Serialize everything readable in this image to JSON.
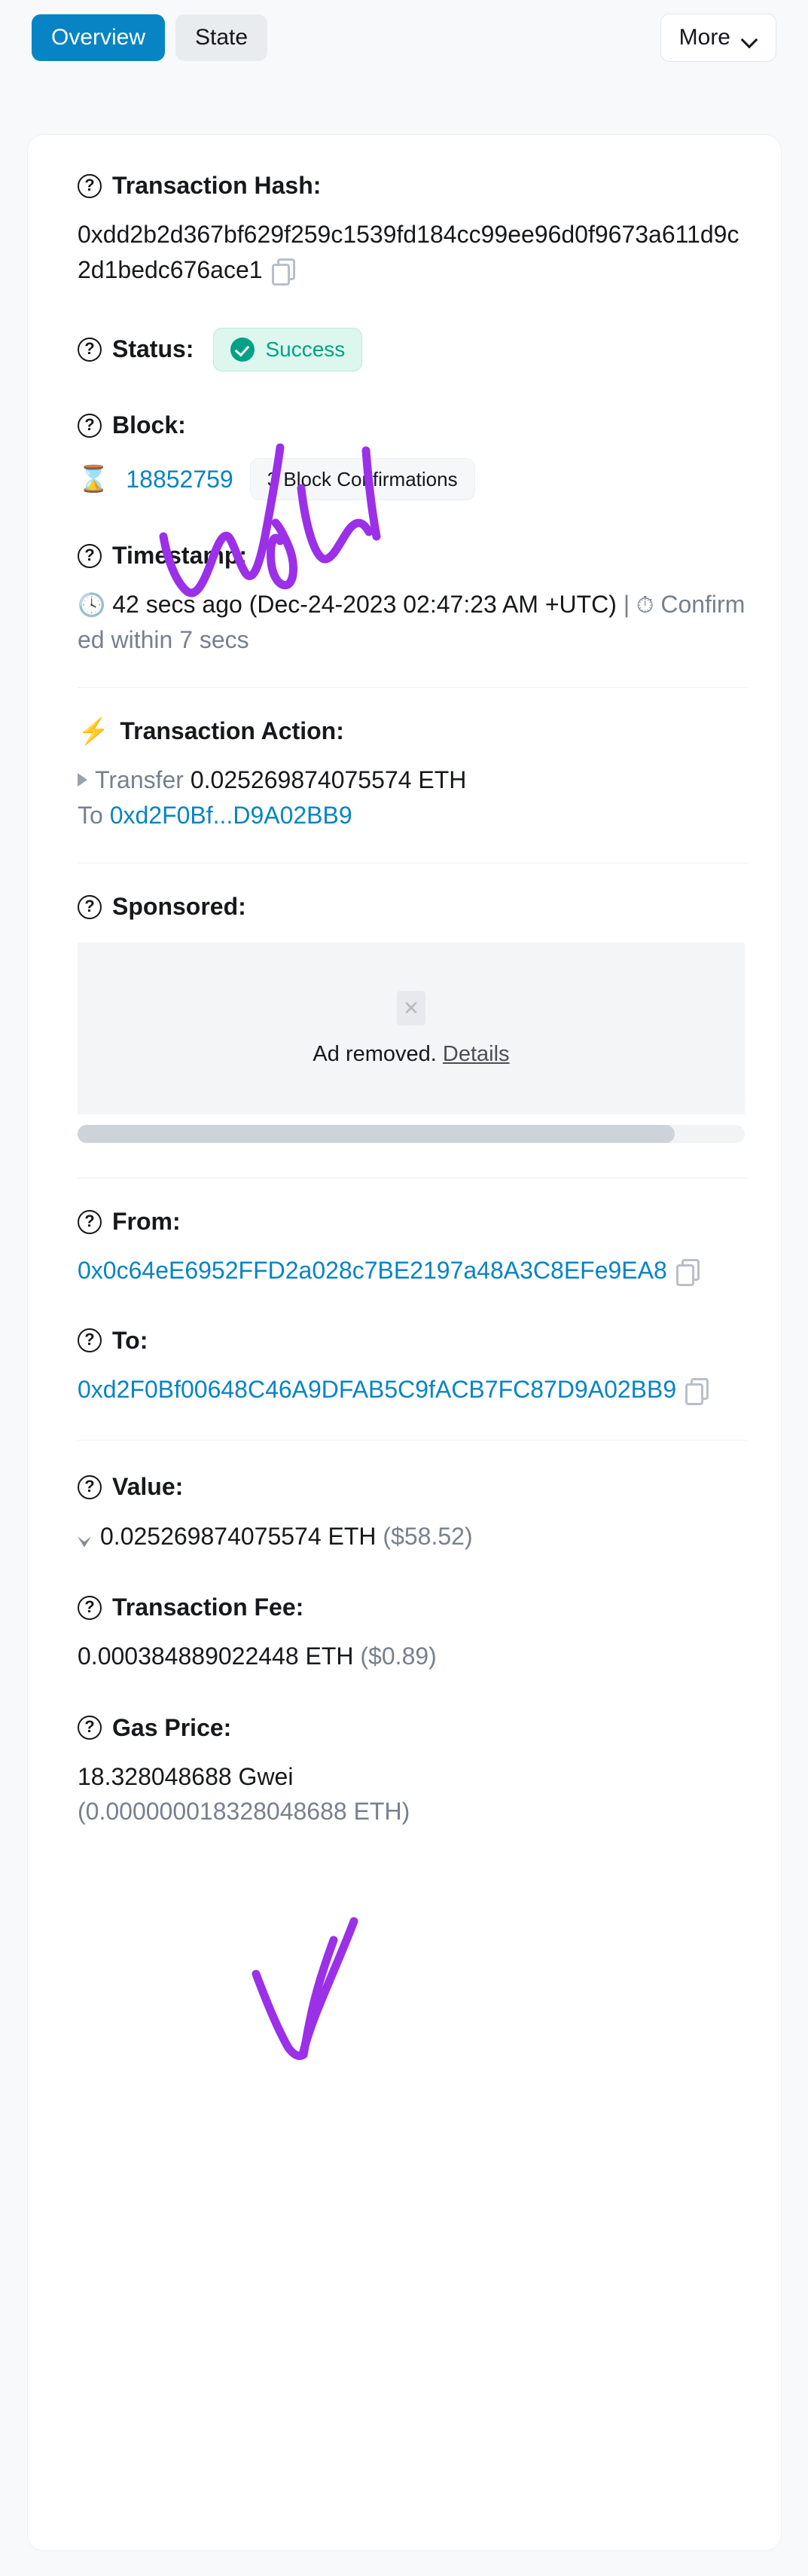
{
  "toolbar": {
    "tabs": [
      {
        "label": "Overview",
        "active": true
      },
      {
        "label": "State",
        "active": false
      }
    ],
    "more_label": "More",
    "chevron_icon": "chevron-down-icon"
  },
  "transaction": {
    "hash": {
      "label": "Transaction Hash:",
      "value": "0xdd2b2d367bf629f259c1539fd184cc99ee96d0f9673a611d9c2d1bedc676ace1",
      "copy_icon": "copy-icon",
      "help_icon": "question-circle-icon"
    },
    "status": {
      "label": "Status:",
      "value": "Success",
      "badge_color": "#00a186",
      "badge_bg": "#ddf7ee",
      "check_icon": "check-circle-icon"
    },
    "block": {
      "label": "Block:",
      "number": "18852759",
      "confirmations": "3 Block Confirmations",
      "icon": "hourglass-icon",
      "link_color": "#0784c3"
    },
    "timestamp": {
      "label": "Timestamp:",
      "relative": "42 secs ago",
      "absolute": "(Dec-24-2023 02:47:23 AM +UTC)",
      "separator": "|",
      "confirmed": "Confirmed within 7 secs",
      "clock_icon": "clock-icon",
      "stopwatch_icon": "stopwatch-icon"
    },
    "action": {
      "label": "Transaction Action:",
      "bolt_icon": "lightning-bolt-icon",
      "verb": "Transfer",
      "amount": "0.025269874075574 ETH",
      "to_word": "To",
      "to_address_short": "0xd2F0Bf...D9A02BB9"
    },
    "sponsored": {
      "label": "Sponsored:",
      "ad_text": "Ad removed.",
      "ad_details": "Details",
      "close_icon": "close-box-icon"
    },
    "from": {
      "label": "From:",
      "address": "0x0c64eE6952FFD2a028c7BE2197a48A3C8EFe9EA8",
      "copy_icon": "copy-icon"
    },
    "to": {
      "label": "To:",
      "address": "0xd2F0Bf00648C46A9DFAB5C9fACB7FC87D9A02BB9",
      "copy_icon": "copy-icon"
    },
    "value": {
      "label": "Value:",
      "eth": "0.025269874075574 ETH",
      "usd": "($58.52)",
      "icon": "ethereum-diamond-icon"
    },
    "fee": {
      "label": "Transaction Fee:",
      "eth": "0.000384889022448 ETH",
      "usd": "($0.89)"
    },
    "gas_price": {
      "label": "Gas Price:",
      "gwei": "18.328048688 Gwei",
      "eth": "(0.000000018328048688 ETH)"
    }
  },
  "annotations": {
    "ink_color": "#9b30e8",
    "handwriting_text": "WoW",
    "arrow": "arrow-pointing-to-value"
  }
}
